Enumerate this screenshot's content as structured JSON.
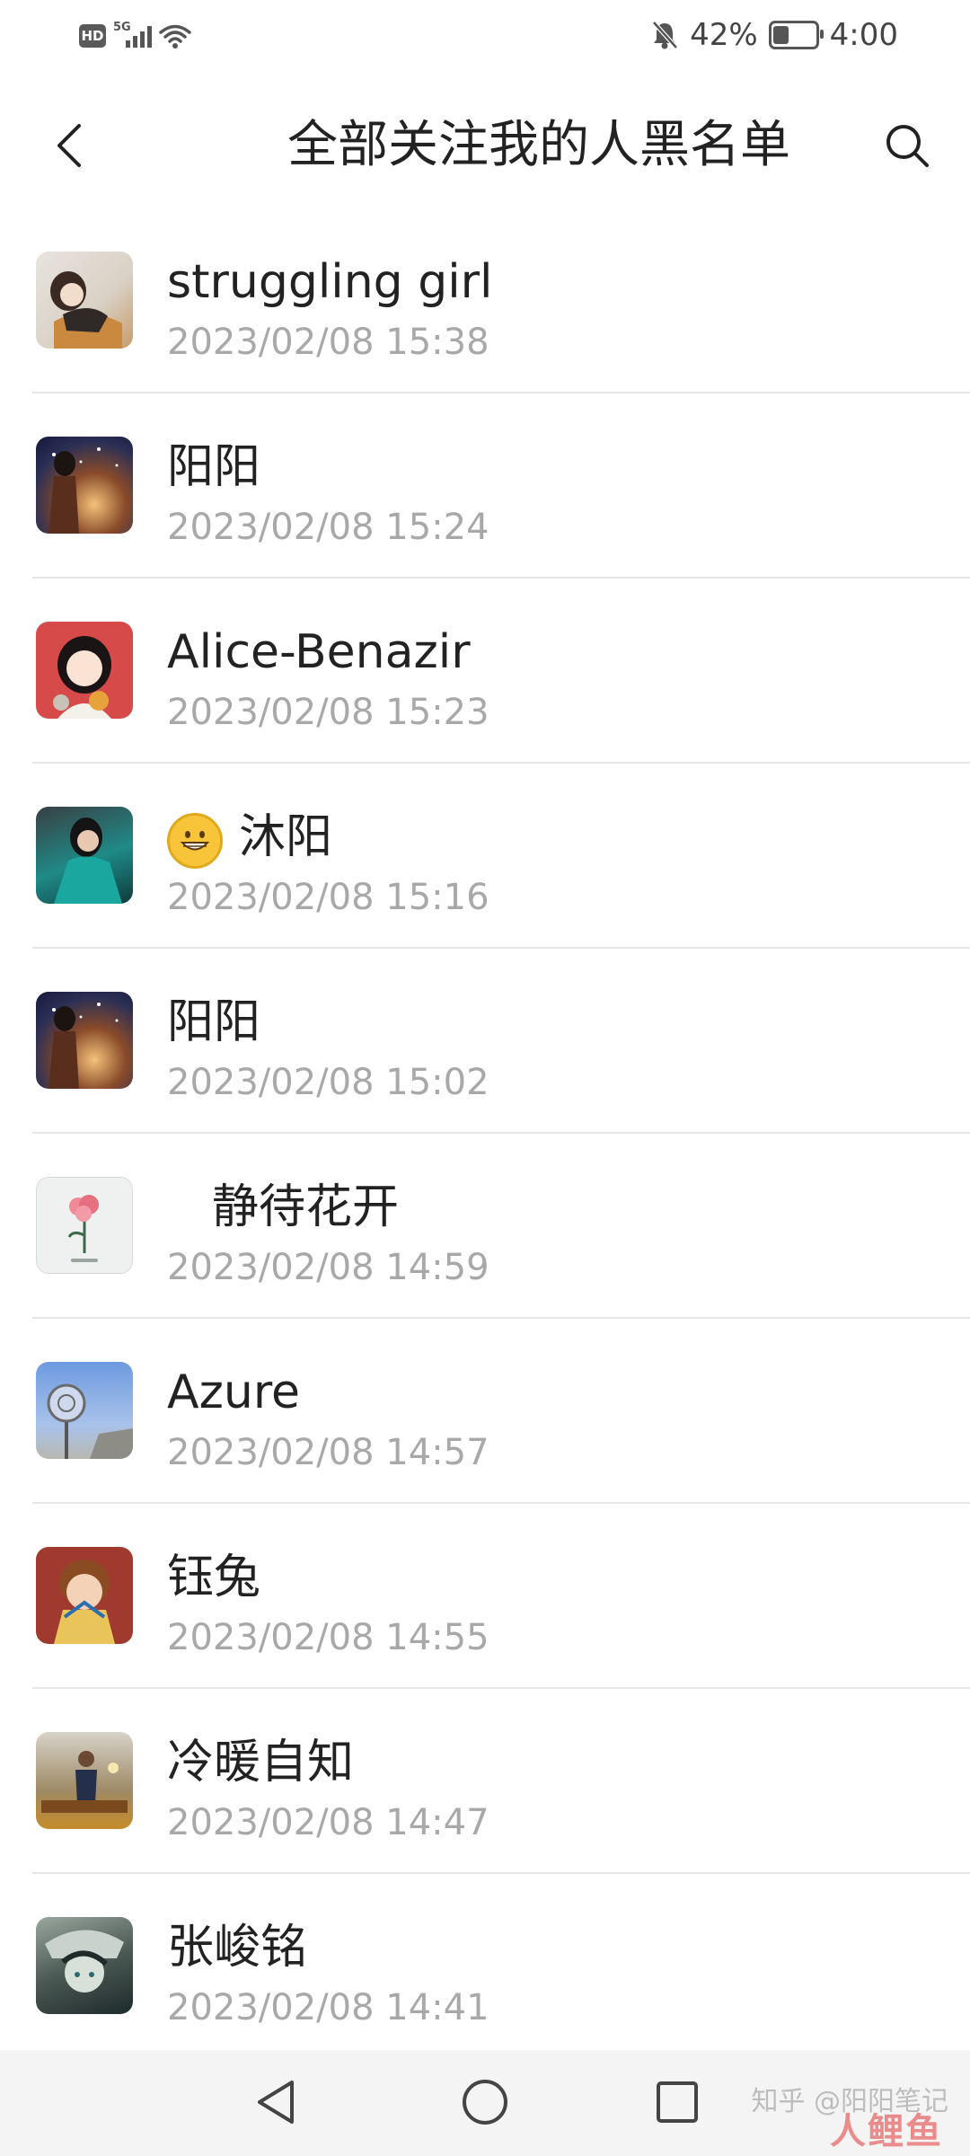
{
  "status_bar": {
    "hd": "HD",
    "network": "5G",
    "battery_percent": "42%",
    "battery_level": 0.42,
    "time": "4:00"
  },
  "header": {
    "title": "全部关注我的人黑名单",
    "back_icon": "chevron-left-icon",
    "search_icon": "search-icon"
  },
  "items": [
    {
      "name": "struggling girl",
      "time": "2023/02/08 15:38"
    },
    {
      "name": "阳阳",
      "time": "2023/02/08 15:24"
    },
    {
      "name": "Alice-Benazir",
      "time": "2023/02/08 15:23"
    },
    {
      "emoji": "grinning-face-emoji",
      "name": "沐阳",
      "time": "2023/02/08 15:16"
    },
    {
      "name": "阳阳",
      "time": "2023/02/08 15:02"
    },
    {
      "name": "静待花开",
      "time": "2023/02/08 14:59"
    },
    {
      "name": "Azure",
      "time": "2023/02/08 14:57"
    },
    {
      "name": "钰兔",
      "time": "2023/02/08 14:55"
    },
    {
      "name": "冷暖自知",
      "time": "2023/02/08 14:47"
    },
    {
      "name": "张峻铭",
      "time": "2023/02/08 14:41"
    }
  ],
  "navbar": {
    "watermark": "知乎 @阳阳笔记",
    "logo_text": "人鲤鱼"
  }
}
